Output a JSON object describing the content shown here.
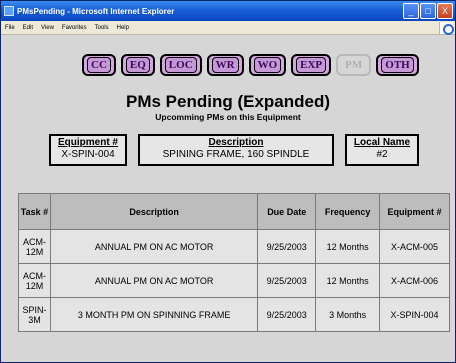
{
  "window": {
    "title": "PMsPending - Microsoft Internet Explorer",
    "controls": [
      "_",
      "□",
      "X"
    ]
  },
  "menu": [
    "File",
    "Edit",
    "View",
    "Favorites",
    "Tools",
    "Help"
  ],
  "nav": [
    {
      "label": "CC",
      "enabled": true
    },
    {
      "label": "EQ",
      "enabled": true
    },
    {
      "label": "LOC",
      "enabled": true
    },
    {
      "label": "WR",
      "enabled": true
    },
    {
      "label": "WO",
      "enabled": true
    },
    {
      "label": "EXP",
      "enabled": true
    },
    {
      "label": "PM",
      "enabled": false
    },
    {
      "label": "OTH",
      "enabled": true
    }
  ],
  "page": {
    "title": "PMs Pending (Expanded)",
    "subtitle": "Upcomming PMs on this Equipment"
  },
  "equipment": {
    "id_label": "Equipment #",
    "id_value": "X-SPIN-004",
    "desc_label": "Description",
    "desc_value": "SPINING FRAME, 160 SPINDLE",
    "local_label": "Local Name",
    "local_value": "#2"
  },
  "table": {
    "headers": [
      "Task #",
      "Description",
      "Due Date",
      "Frequency",
      "Equipment #"
    ],
    "rows": [
      [
        "ACM-12M",
        "ANNUAL PM ON AC MOTOR",
        "9/25/2003",
        "12 Months",
        "X-ACM-005"
      ],
      [
        "ACM-12M",
        "ANNUAL PM ON AC MOTOR",
        "9/25/2003",
        "12 Months",
        "X-ACM-006"
      ],
      [
        "SPIN-3M",
        "3 MONTH PM ON SPINNING FRAME",
        "9/25/2003",
        "3 Months",
        "X-SPIN-004"
      ]
    ]
  },
  "colors": {
    "nav_fill": "#d4a6e0",
    "nav_text": "#3a0a56",
    "titlebar": "#1a5fd6"
  }
}
